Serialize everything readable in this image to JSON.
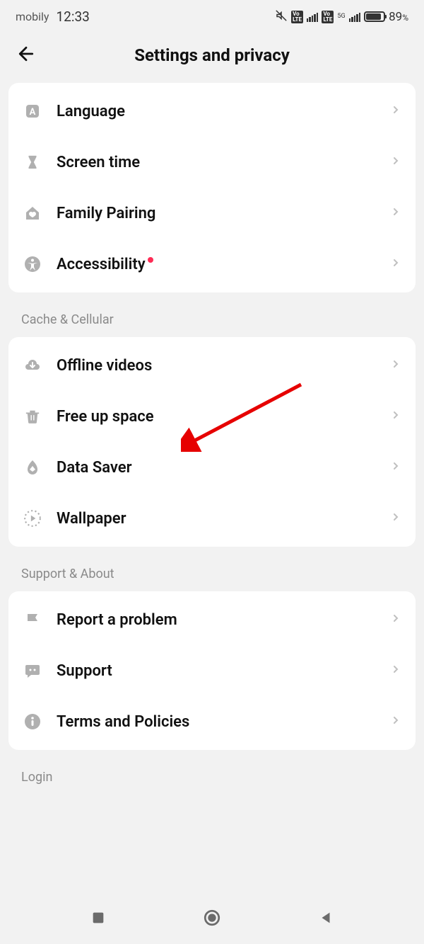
{
  "statusBar": {
    "carrier": "mobily",
    "time": "12:33",
    "battery": "89",
    "batteryPct": "%",
    "network": "5G"
  },
  "header": {
    "title": "Settings and privacy"
  },
  "sections": {
    "group1": {
      "items": {
        "language": {
          "label": "Language"
        },
        "screenTime": {
          "label": "Screen time"
        },
        "familyPairing": {
          "label": "Family Pairing"
        },
        "accessibility": {
          "label": "Accessibility"
        }
      }
    },
    "cacheCellular": {
      "title": "Cache & Cellular",
      "items": {
        "offlineVideos": {
          "label": "Offline videos"
        },
        "freeUpSpace": {
          "label": "Free up space"
        },
        "dataSaver": {
          "label": "Data Saver"
        },
        "wallpaper": {
          "label": "Wallpaper"
        }
      }
    },
    "supportAbout": {
      "title": "Support & About",
      "items": {
        "reportProblem": {
          "label": "Report a problem"
        },
        "support": {
          "label": "Support"
        },
        "termsPolicies": {
          "label": "Terms and Policies"
        }
      }
    },
    "login": {
      "title": "Login"
    }
  }
}
